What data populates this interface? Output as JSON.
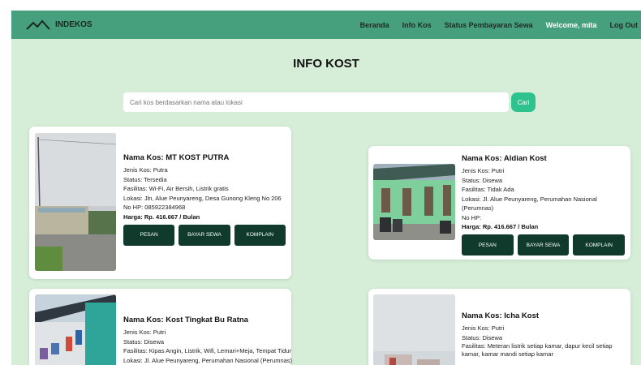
{
  "navbar": {
    "brand": "INDEKOS",
    "links": [
      "Beranda",
      "Info Kos",
      "Status Pembayaran Sewa"
    ],
    "welcome": "Welcome, mita",
    "logout": "Log Out"
  },
  "page": {
    "title": "INFO KOST"
  },
  "search": {
    "placeholder": "Cari kos berdasarkan nama atau lokasi",
    "value": "",
    "button": "Cari"
  },
  "labels": {
    "name": "Nama Kos: ",
    "jenis": "Jenis Kos: ",
    "status": "Status: ",
    "fasilitas": "Fasilitas: ",
    "lokasi": "Lokasi: ",
    "hp": "No HP: ",
    "harga": "Harga: "
  },
  "buttons": {
    "pesan": "PESAN",
    "bayar": "BAYAR SEWA",
    "komplain": "KOMPLAIN"
  },
  "listings": [
    {
      "name": "MT KOST PUTRA",
      "jenis": "Putra",
      "status": "Tersedia",
      "fasilitas": "Wi-Fi, Air Bersih, Listrik gratis",
      "lokasi": "Jln, Alue Peunyareng, Desa Gunong Kleng No 206",
      "hp": "085922384968",
      "harga": "Rp. 416.667 / Bulan"
    },
    {
      "name": "Aldian Kost",
      "jenis": "Putri",
      "status": "Disewa",
      "fasilitas": "Tidak Ada",
      "lokasi": "Jl. Alue Peunyareng, Perumahan Nasional (Perumnas)",
      "hp": "",
      "harga": "Rp. 416.667 / Bulan"
    },
    {
      "name": "Kost Tingkat Bu Ratna",
      "jenis": "Putri",
      "status": "Disewa",
      "fasilitas": "Kipas Angin, Listrik, Wifi, Lemari+Meja, Tempat Tidur",
      "lokasi": "Jl. Alue Peunyareng, Perumahan Nasional (Perumnas)"
    },
    {
      "name": "Icha Kost",
      "jenis": "Putri",
      "status": "Disewa",
      "fasilitas": "Meteran listrik setiap kamar, dapur kecil setiap kamar, kamar mandi setiap kamar"
    }
  ]
}
